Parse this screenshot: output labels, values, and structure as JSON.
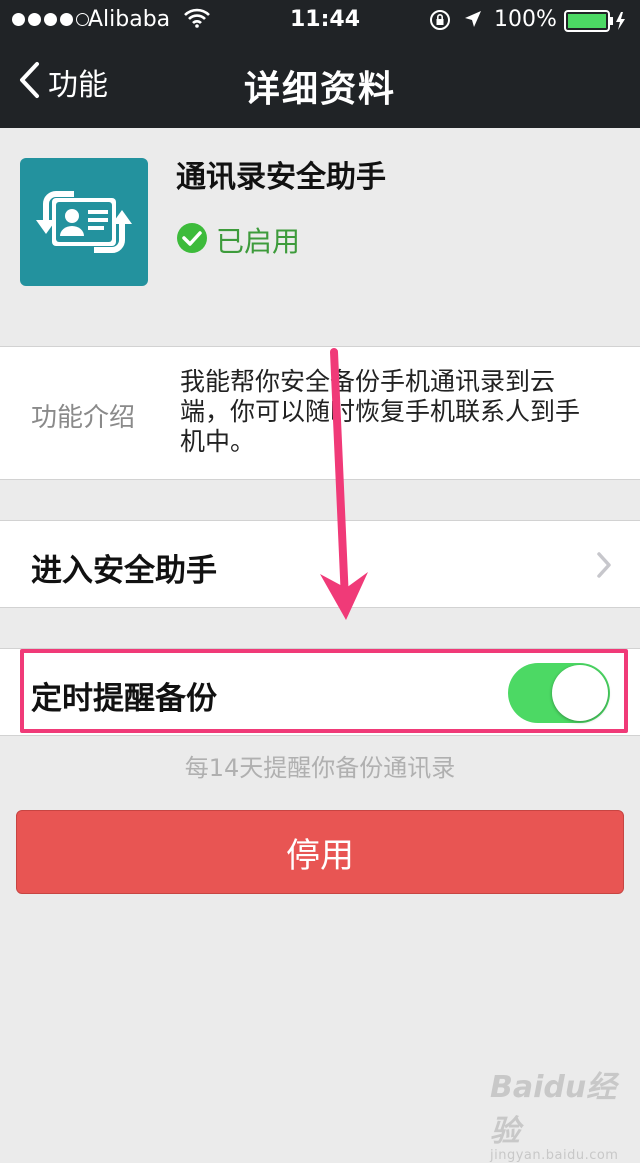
{
  "status_bar": {
    "carrier": "Alibaba",
    "time": "11:44",
    "battery": "100%",
    "signal_icon": "signal-dots-icon",
    "wifi_icon": "wifi-icon"
  },
  "nav": {
    "back_label": "功能",
    "title": "详细资料"
  },
  "app": {
    "name": "通讯录安全助手",
    "status": "已启用",
    "status_color": "#3d9b3b",
    "icon_color": "#23929e"
  },
  "intro": {
    "label": "功能介绍",
    "text": "我能帮你安全备份手机通讯录到云端，你可以随时恢复手机联系人到手机中。"
  },
  "enter_row": {
    "label": "进入安全助手"
  },
  "reminder_row": {
    "label": "定时提醒备份",
    "toggle_on": true,
    "hint": "每14天提醒你备份通讯录"
  },
  "disable_button": {
    "label": "停用",
    "color": "#e85553"
  },
  "annotation": {
    "color": "#f03a78"
  },
  "watermark": {
    "brand": "Baidu经验",
    "site": "jingyan.baidu.com"
  }
}
